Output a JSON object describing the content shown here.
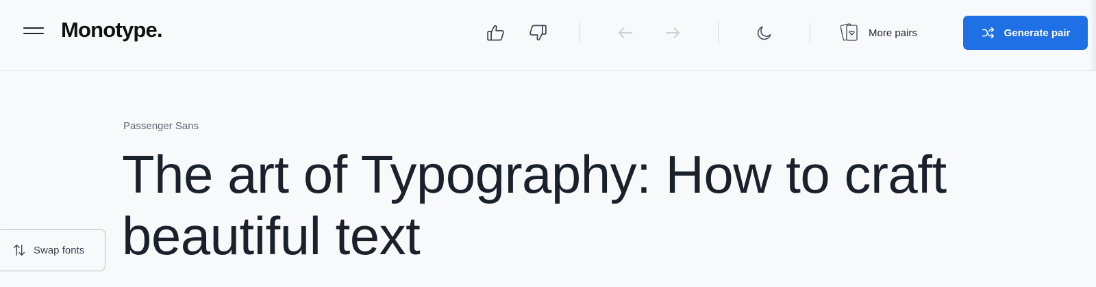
{
  "header": {
    "logo": "Monotype.",
    "more_pairs_label": "More pairs",
    "generate_label": "Generate pair",
    "accent_color": "#1f6fe5",
    "icons": [
      "menu-icon",
      "thumbs-up-icon",
      "thumbs-down-icon",
      "arrow-left-icon",
      "arrow-right-icon",
      "moon-icon",
      "cards-heart-icon",
      "shuffle-icon"
    ]
  },
  "main": {
    "font_name": "Passenger Sans",
    "headline": "The art of Typography: How to craft beautiful text"
  },
  "sidebar": {
    "swap_label": "Swap fonts",
    "swap_icon": "swap-vertical-icon"
  }
}
